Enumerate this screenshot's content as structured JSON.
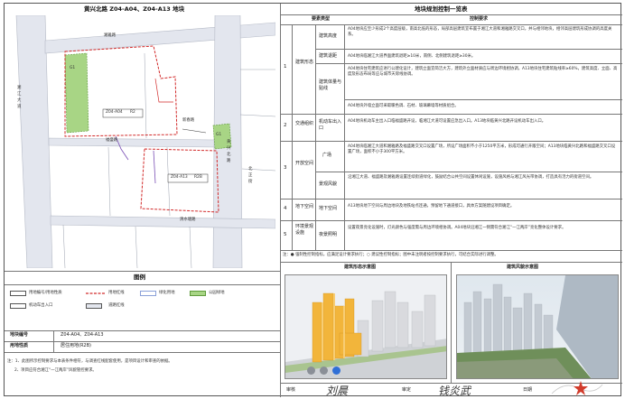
{
  "map": {
    "title": "黄兴北路 Z04-A04、Z04-A13 地块",
    "labels": {
      "road_top": "湘雅路",
      "road_left": "湘江大道",
      "road_right": "黄兴北路",
      "road_mid": "福盛路",
      "road_bottom": "清水塘路",
      "lot1": "Z04-A04",
      "lot1_code": "R2",
      "lot2": "Z04-A13",
      "lot2_code": "R2B",
      "green1": "G1",
      "green2": "G1",
      "street": "新春路",
      "road_right2": "北正街"
    }
  },
  "legend": {
    "heading": "图例",
    "items": [
      {
        "label": "用地编号/用地性质"
      },
      {
        "label": "用地红线"
      },
      {
        "label": "绿化用地"
      },
      {
        "label": "公园绿地"
      },
      {
        "label": "机动车出入口"
      },
      {
        "label": "道路红线"
      }
    ]
  },
  "info": {
    "row1_label": "地块编号",
    "row1_value": "Z04-A04、Z04-A13",
    "row2_label": "用地性质",
    "row2_value": "居住用地(R2B)"
  },
  "notes": {
    "line1": "注：1、此图所示控制要求与本表条件相符，与调查红线配套使用，是项目设计和审查的依据。",
    "line2": "2、项目应符合湘江“一江两岸”风貌管控要求。"
  },
  "table": {
    "title": "地块规划控制一览表",
    "header_type": "要素类型",
    "header_req": "控制要求",
    "sections": [
      {
        "num": "1",
        "name": "建筑形态",
        "rows": [
          {
            "item": "建筑高度",
            "text": "A04地块应至少形成2个高度层级，南高北低的形态，局部高层建筑宜布置于湘江大道和湘雅路交叉口，并与相邻地块，相邻高层建筑形成协调的高度关系。"
          },
          {
            "item": "建筑退距",
            "text": "A04地块临湘江大道界面建筑退距≥10米，南侧、北侧建筑退距≥30米。"
          },
          {
            "item": "建筑体量与贴线",
            "text": "A04地块住宅建筑应进行公建化设计，建筑立面宜简洁大方，建筑外立面材质应与周边环境相协调，A13地块住宅建筑贴线率≥60%，建筑高度、立面、高度及形态布局等应与城市天际线协调。"
          },
          {
            "item": "",
            "text": "A04地块外墙立面可采取暖色调、石材、玻璃幕墙等材质组合。"
          }
        ]
      },
      {
        "num": "2",
        "name": "交通组织",
        "rows": [
          {
            "item": "机动车出入口",
            "text": "A04地块机动车主出入口临福盛路开设，临湘江大道可设置应急出入口。A13地块临黄兴北路开设机动车出入口。"
          }
        ]
      },
      {
        "num": "3",
        "name": "开放空间",
        "rows": [
          {
            "item": "广场",
            "text": "A04地块临湘江大道和湘雅路及福盛路交叉口设置广场，所设广场面积不小于1250平方米，形成可通行开敞空间；A13地块临黄兴北路和福盛路交叉口设置广场，面积不小于300平方米。"
          },
          {
            "item": "景观风貌",
            "text": "沿湘江大道、福盛路及湘雅路设置连续街道绿化，鼓励结合公共空间设置休闲设施，设施风格与湘江风光带协调，打造具有活力的街道空间。"
          }
        ]
      },
      {
        "num": "4",
        "name": "地下空间",
        "rows": [
          {
            "item": "地下空间",
            "text": "A13地块地下空间与周边地块及地铁站点连通，预留地下通道接口，具体方案随建设项目确定。"
          }
        ]
      },
      {
        "num": "5",
        "name": "环境景观设施",
        "rows": [
          {
            "item": "夜景照明",
            "text": "设置夜景亮化设施时，灯光颜色与强度需与周边环境相协调。A04地块沿湘江一侧需符合湘江“一江两岸”亮化整体设计要求。"
          }
        ]
      }
    ],
    "footnote": "注：● 强制性控制指标，应满足设计要求执行；○ 建议性控制指标；图中未注明者按控制要求执行，可结合实际进行调整。"
  },
  "images": {
    "left_caption": "建筑形态示意图",
    "right_caption": "建筑风貌示意图"
  },
  "signoff": {
    "label1": "审核",
    "sig1": "刘晨",
    "label2": "审定",
    "sig2": "钱炎武",
    "label3": "日期"
  },
  "colors": {
    "road_fill": "#d9dde6",
    "lot_line": "#d22a2a",
    "green": "#9fd07a",
    "building_orange": "#f1b43a",
    "building_grey": "#dcdcdc",
    "stamp": "#d23c2c"
  }
}
